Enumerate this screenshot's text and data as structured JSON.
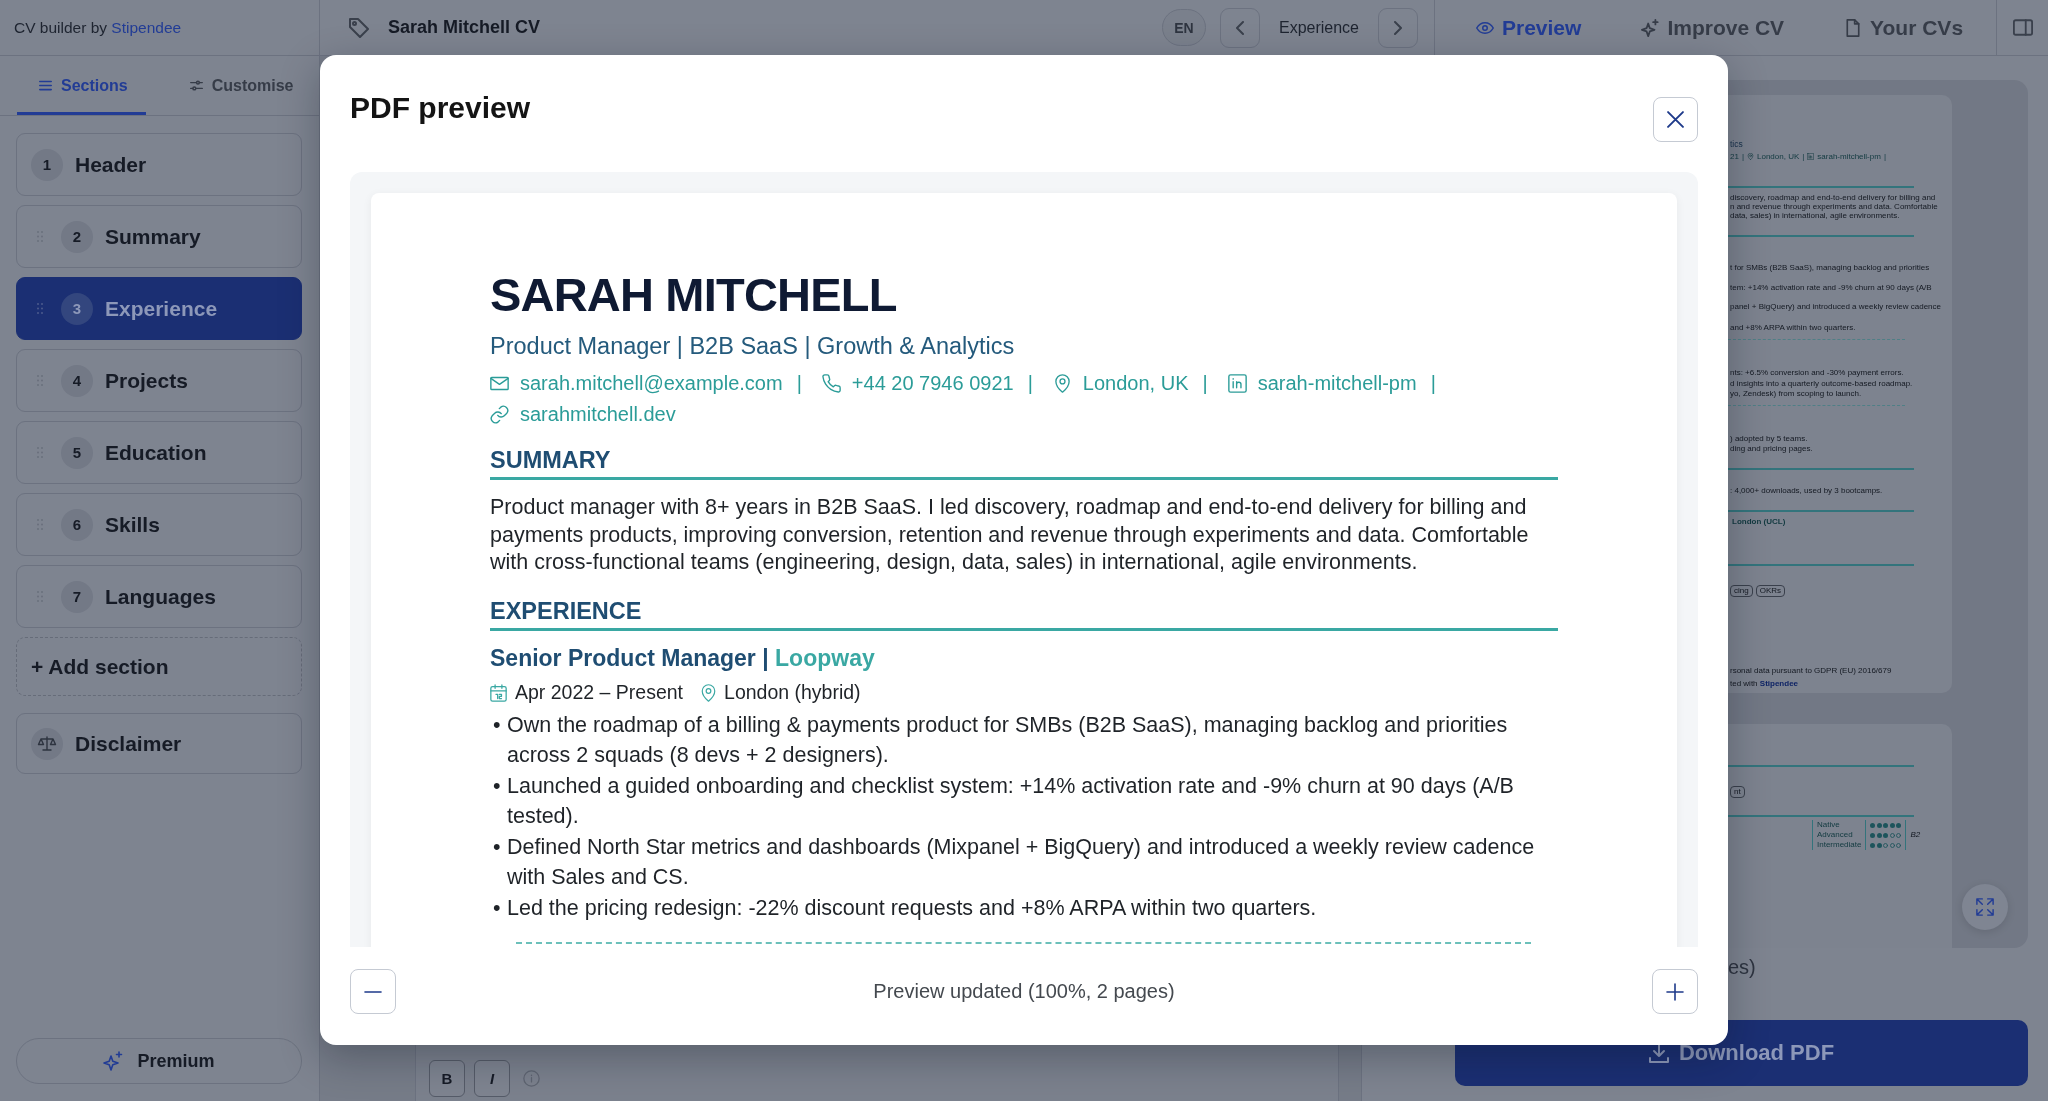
{
  "topbar": {
    "brand_prefix": "CV builder by",
    "brand_link": "Stipendee",
    "document_title": "Sarah Mitchell CV",
    "language": "EN",
    "current_section": "Experience",
    "tabs": [
      {
        "label": "Preview",
        "selected": true
      },
      {
        "label": "Improve CV",
        "selected": false
      },
      {
        "label": "Your CVs",
        "selected": false
      }
    ]
  },
  "sidebar": {
    "tabs": [
      {
        "label": "Sections",
        "selected": true
      },
      {
        "label": "Customise",
        "selected": false
      }
    ],
    "sections": [
      {
        "number": "1",
        "label": "Header",
        "draggable": false,
        "selected": false
      },
      {
        "number": "2",
        "label": "Summary",
        "draggable": true,
        "selected": false
      },
      {
        "number": "3",
        "label": "Experience",
        "draggable": true,
        "selected": true
      },
      {
        "number": "4",
        "label": "Projects",
        "draggable": true,
        "selected": false
      },
      {
        "number": "5",
        "label": "Education",
        "draggable": true,
        "selected": false
      },
      {
        "number": "6",
        "label": "Skills",
        "draggable": true,
        "selected": false
      },
      {
        "number": "7",
        "label": "Languages",
        "draggable": true,
        "selected": false
      }
    ],
    "add_section": "+ Add section",
    "disclaimer": "Disclaimer",
    "premium": "Premium"
  },
  "editor": {
    "format_buttons": [
      {
        "kind": "bold",
        "label": "B"
      },
      {
        "kind": "italic",
        "label": "I"
      }
    ]
  },
  "preview_panel": {
    "pages": [
      {
        "lines": [
          {
            "kind": "headline",
            "text": "tics"
          },
          {
            "kind": "contacts",
            "items": [
              {
                "text": "21",
                "separator": "|"
              },
              {
                "kind": "location",
                "text": "London, UK",
                "separator": "|"
              },
              {
                "kind": "linkedin",
                "text": "sarah-mitchell-pm",
                "separator": "|"
              }
            ]
          },
          {
            "kind": "rule"
          },
          {
            "kind": "text",
            "text": "discovery, roadmap and end-to-end delivery for billing and"
          },
          {
            "kind": "text",
            "text": "n and revenue through experiments and data. Comfortable"
          },
          {
            "kind": "text",
            "text": "data, sales) in international, agile environments."
          },
          {
            "kind": "rule"
          },
          {
            "kind": "text",
            "text": "t for SMBs (B2B SaaS), managing backlog and priorities"
          },
          {
            "kind": "text",
            "text": "tem: +14% activation rate and -9% churn at 90 days (A/B"
          },
          {
            "kind": "text",
            "text": "panel + BigQuery) and introduced a weekly review cadence"
          },
          {
            "kind": "text",
            "text": "and +8% ARPA within two quarters."
          },
          {
            "kind": "dashed"
          },
          {
            "kind": "text",
            "text": "nts: +6.5% conversion and -30% payment errors."
          },
          {
            "kind": "text",
            "text": "d insights into a quarterly outcome-based roadmap."
          },
          {
            "kind": "text",
            "text": "yo, Zendesk) from scoping to launch."
          },
          {
            "kind": "dashed"
          },
          {
            "kind": "text",
            "text": ") adopted by 5 teams."
          },
          {
            "kind": "text",
            "text": "ding and pricing pages."
          },
          {
            "kind": "rule"
          },
          {
            "kind": "text",
            "text": ": 4,000+ downloads, used by 3 bootcamps."
          },
          {
            "kind": "rule"
          },
          {
            "kind": "accent",
            "text": "London (UCL)"
          },
          {
            "kind": "rule"
          },
          {
            "kind": "tags",
            "tags": [
              "cing",
              "OKRs"
            ]
          },
          {
            "kind": "note",
            "text": "rsonal data pursuant to GDPR (EU) 2016/679"
          },
          {
            "kind": "note",
            "text": "ted with **Stipendee**"
          }
        ]
      },
      {
        "lines": [
          {
            "kind": "rule"
          },
          {
            "kind": "tags",
            "tags": [
              "nt"
            ]
          },
          {
            "kind": "rule"
          },
          {
            "kind": "languages",
            "rows": [
              {
                "label": "Native",
                "stars": 5
              },
              {
                "label": "Advanced",
                "stars": 3,
                "note": "B2"
              },
              {
                "label": "Intermediate",
                "stars": 2
              }
            ]
          }
        ]
      }
    ],
    "status": "es)",
    "download": "Download PDF"
  },
  "modal": {
    "title": "PDF preview",
    "document": {
      "name": "SARAH MITCHELL",
      "headline": "Product Manager | B2B SaaS | Growth & Analytics",
      "contacts": [
        {
          "kind": "email",
          "text": "sarah.mitchell@example.com",
          "separator": "|"
        },
        {
          "kind": "phone",
          "text": "+44 20 7946 0921",
          "separator": "|"
        },
        {
          "kind": "location",
          "text": "London, UK",
          "separator": "|"
        },
        {
          "kind": "linkedin",
          "text": "sarah-mitchell-pm",
          "separator": "|"
        },
        {
          "kind": "website",
          "text": "sarahmitchell.dev"
        }
      ],
      "sections": [
        {
          "kind": "text",
          "heading": "SUMMARY",
          "text": "Product manager with 8+ years in B2B SaaS. I led discovery, roadmap and end-to-end delivery for billing and payments products, improving conversion, retention and revenue through experiments and data. Comfortable with cross-functional teams (engineering, design, data, sales) in international, agile environments."
        },
        {
          "kind": "jobs",
          "heading": "EXPERIENCE",
          "jobs": [
            {
              "role": "Senior Product Manager",
              "separator": "|",
              "company": "Loopway",
              "dates": "Apr 2022 – Present",
              "location": "London (hybrid)",
              "bullets": [
                {
                  "marker": "•",
                  "text": "Own the roadmap of a billing & payments product for SMBs (B2B SaaS), managing backlog and priorities across 2 squads (8 devs + 2 designers)."
                },
                {
                  "marker": "•",
                  "text": "Launched a guided onboarding and checklist system: +14% activation rate and -9% churn at 90 days (A/B tested)."
                },
                {
                  "marker": "•",
                  "text": "Defined North Star metrics and dashboards (Mixpanel + BigQuery) and introduced a weekly review cadence with Sales and CS."
                },
                {
                  "marker": "•",
                  "text": "Led the pricing redesign: -22% discount requests and +8% ARPA within two quarters."
                }
              ]
            }
          ]
        }
      ]
    },
    "status": "Preview updated (100%, 2 pages)"
  }
}
